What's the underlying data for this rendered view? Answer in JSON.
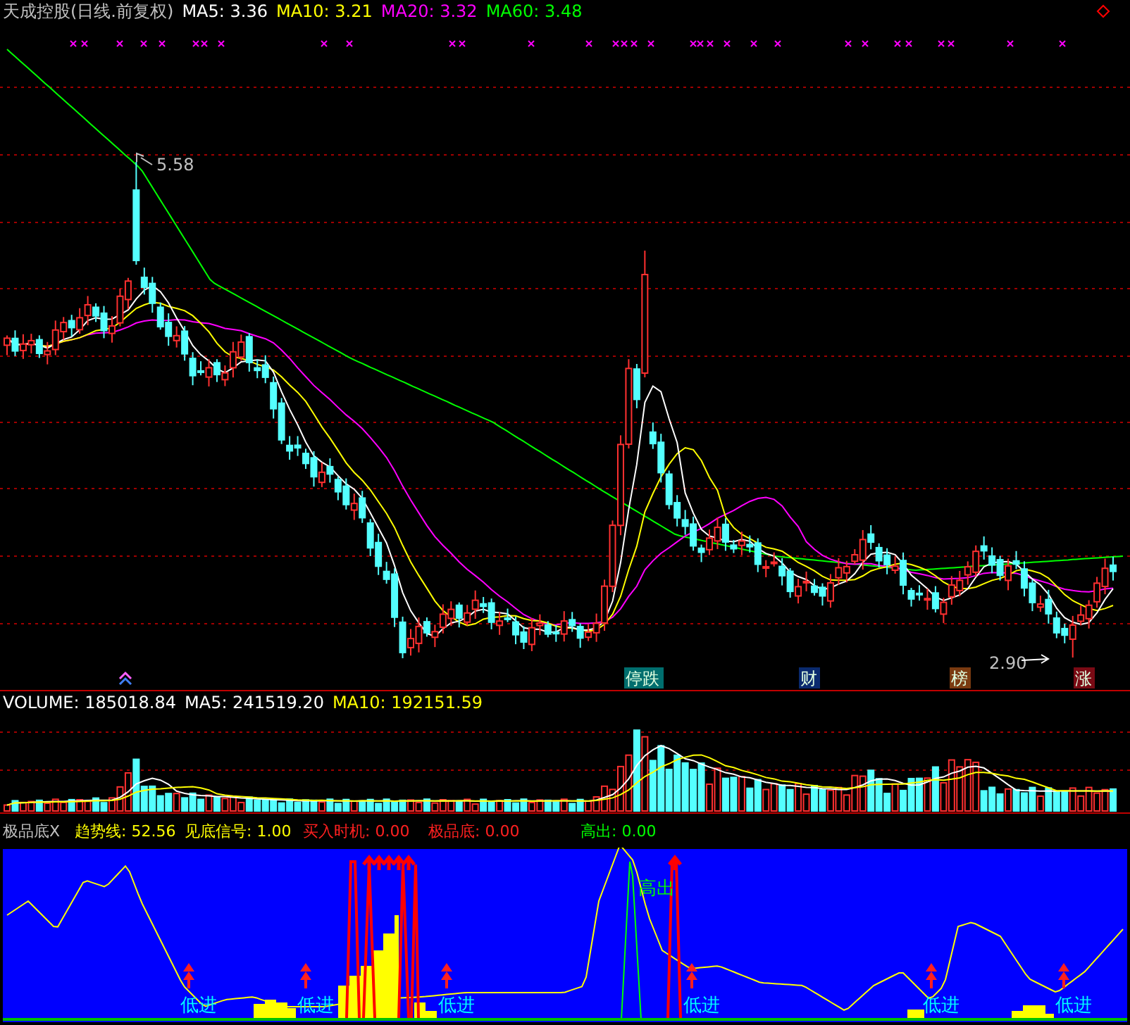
{
  "price_panel": {
    "title": "天成控股(日线.前复权)",
    "ma_labels": [
      {
        "text": "MA5: 3.36",
        "color": "#ffffff"
      },
      {
        "text": "MA10: 3.21",
        "color": "#ffff00"
      },
      {
        "text": "MA20: 3.32",
        "color": "#ff00ff"
      },
      {
        "text": "MA60: 3.48",
        "color": "#00ff00"
      }
    ],
    "high_label": "5.58",
    "low_label": "2.90",
    "events": [
      {
        "label": "停跌",
        "color": "#006e6e"
      },
      {
        "label": "财",
        "color": "#0a2a6e"
      },
      {
        "label": "榜",
        "color": "#7a3a10"
      },
      {
        "label": "涨",
        "color": "#7a0a14"
      }
    ]
  },
  "volume_panel": {
    "labels": [
      {
        "text": "VOLUME: 185018.84",
        "color": "#ffffff"
      },
      {
        "text": "MA5: 241519.20",
        "color": "#ffffff"
      },
      {
        "text": "MA10: 192151.59",
        "color": "#ffff00"
      }
    ]
  },
  "indicator_panel": {
    "title": "极品底X",
    "labels": [
      {
        "text": "趋势线: 52.56",
        "color": "#ffff00"
      },
      {
        "text": "见底信号: 1.00",
        "color": "#ffff00"
      },
      {
        "text": "买入时机: 0.00",
        "color": "#ff2020"
      },
      {
        "text": "极品底: 0.00",
        "color": "#ff2020"
      },
      {
        "text": "高出: 0.00",
        "color": "#00ff00"
      }
    ],
    "signals": [
      {
        "label": "低进",
        "kind": "buy"
      },
      {
        "label": "低进",
        "kind": "buy"
      },
      {
        "label": "低进",
        "kind": "buy"
      },
      {
        "label": "高出",
        "kind": "sell"
      },
      {
        "label": "低进",
        "kind": "buy"
      },
      {
        "label": "低进",
        "kind": "buy"
      },
      {
        "label": "低进",
        "kind": "buy"
      }
    ]
  }
}
